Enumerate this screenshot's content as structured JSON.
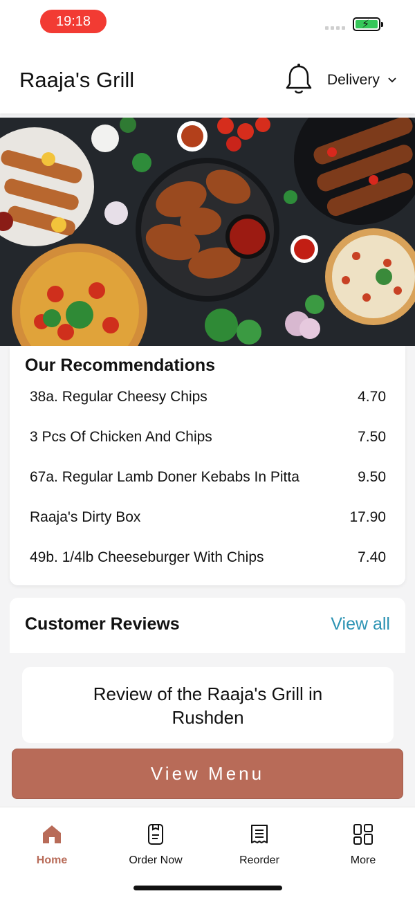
{
  "status_bar": {
    "time": "19:18"
  },
  "header": {
    "title": "Raaja's Grill",
    "mode_label": "Delivery"
  },
  "recommendations": {
    "title": "Our Recommendations",
    "items": [
      {
        "name": "38a. Regular Cheesy Chips",
        "price": "4.70"
      },
      {
        "name": "3 Pcs Of Chicken And Chips",
        "price": "7.50"
      },
      {
        "name": "67a. Regular Lamb Doner Kebabs In Pitta",
        "price": "9.50"
      },
      {
        "name": "Raaja's Dirty Box",
        "price": "17.90"
      },
      {
        "name": "49b. 1/4lb Cheeseburger With Chips",
        "price": "7.40"
      }
    ]
  },
  "reviews": {
    "title": "Customer Reviews",
    "view_all_label": "View all",
    "review_title": "Review of the Raaja's Grill in Rushden"
  },
  "view_menu_label": "View Menu",
  "nav": {
    "items": [
      {
        "label": "Home",
        "icon": "home-icon",
        "active": true
      },
      {
        "label": "Order Now",
        "icon": "order-icon",
        "active": false
      },
      {
        "label": "Reorder",
        "icon": "receipt-icon",
        "active": false
      },
      {
        "label": "More",
        "icon": "grid-icon",
        "active": false
      }
    ]
  },
  "colors": {
    "accent": "#b86b58",
    "link": "#2b93b3",
    "status_pill": "#f23b33"
  }
}
